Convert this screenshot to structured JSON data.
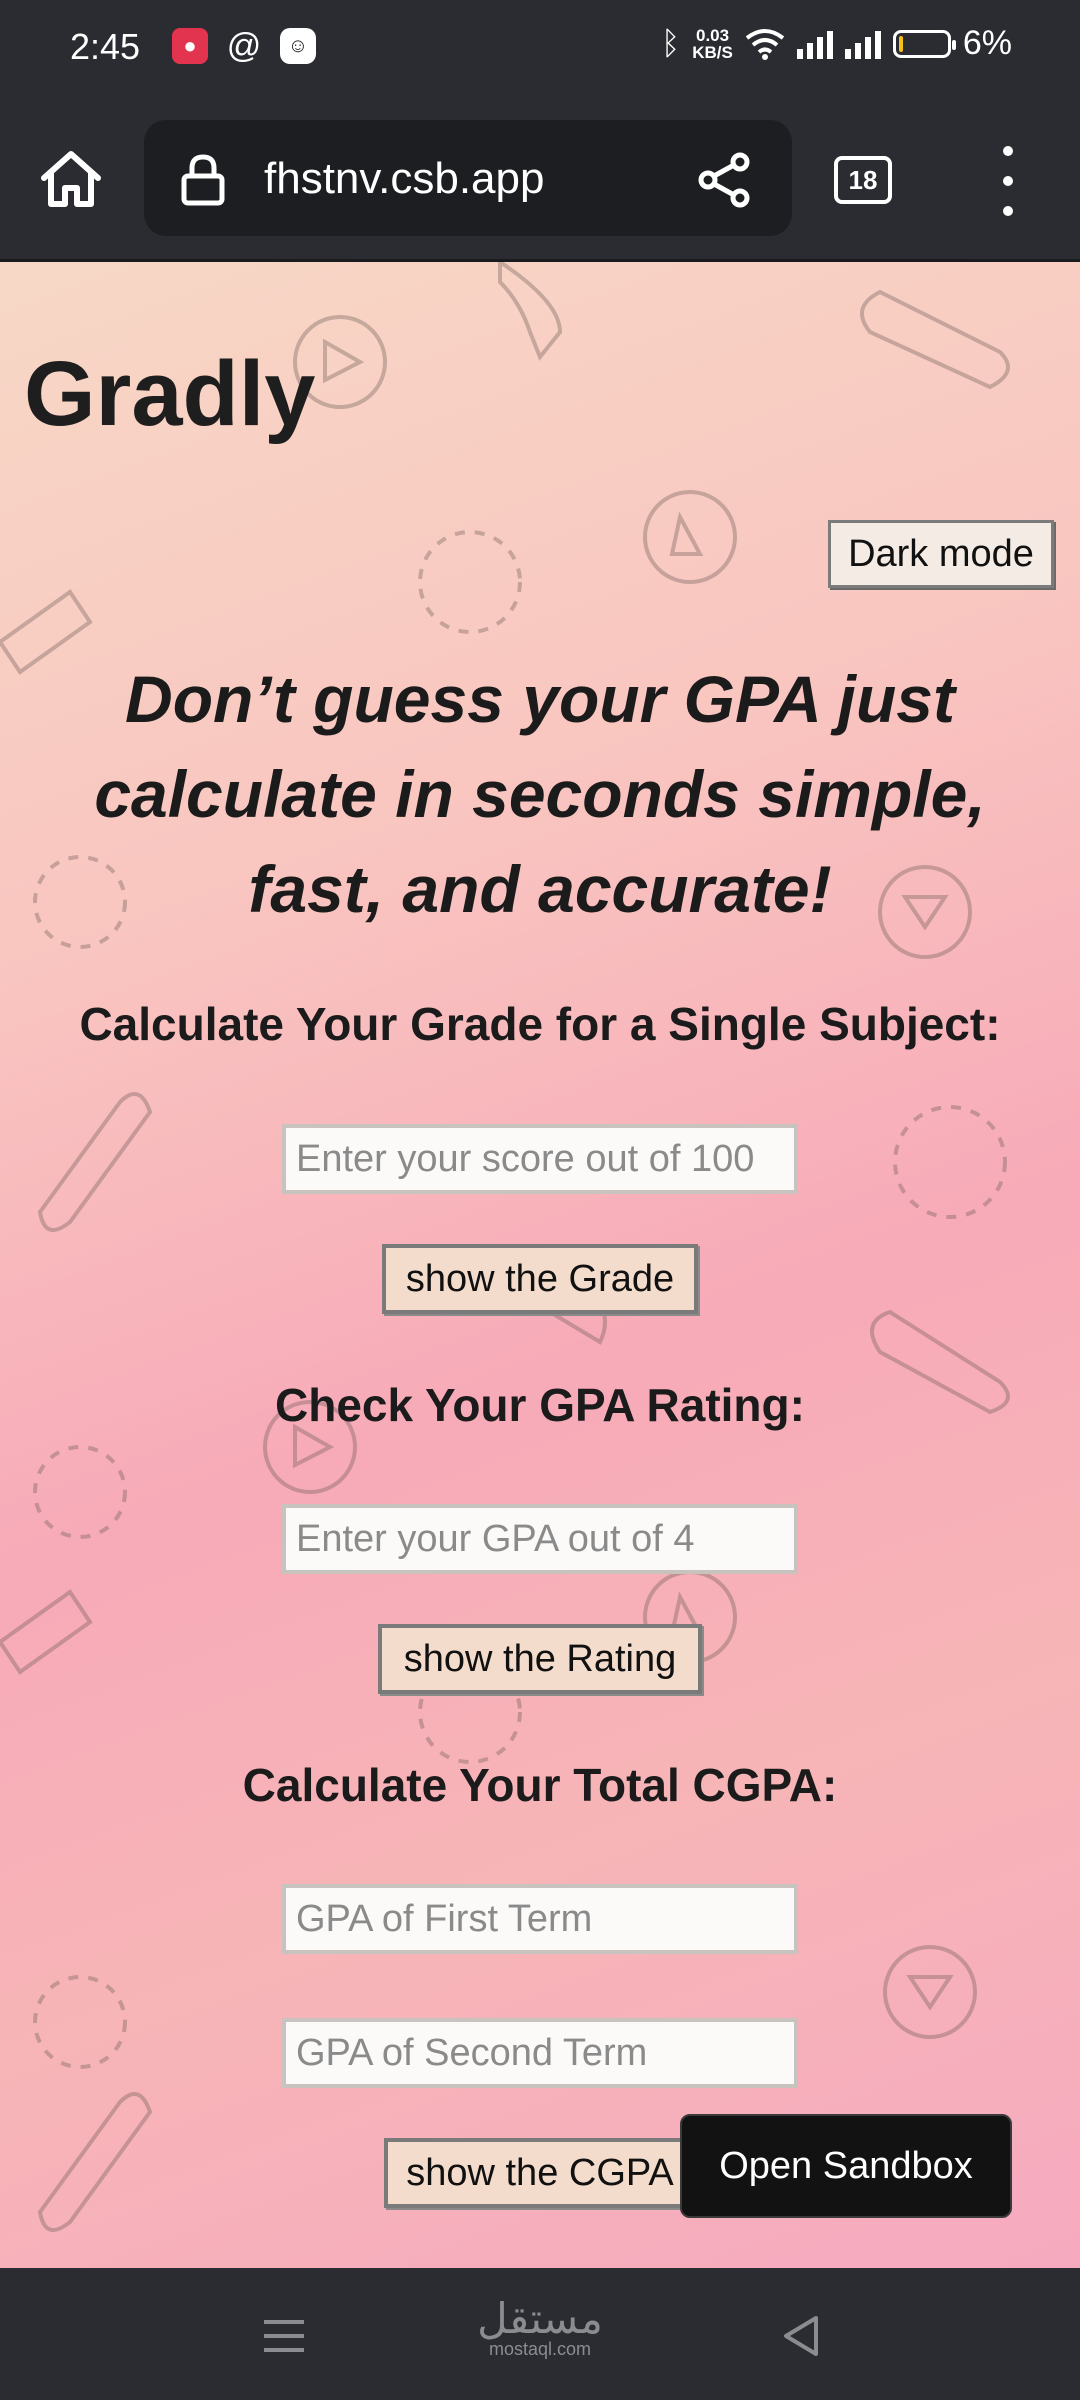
{
  "status_bar": {
    "time": "2:45",
    "net_speed": "0.03",
    "net_unit": "KB/S",
    "battery": "6%",
    "battery_level": 0.06
  },
  "browser": {
    "url": "fhstnv.csb.app",
    "tab_count": "18"
  },
  "page": {
    "title": "Gradly",
    "dark_mode_label": "Dark mode",
    "hero": "Don’t guess your GPA just calculate in seconds simple, fast, and accurate!",
    "grade_section": {
      "heading": "Calculate Your Grade for a Single Subject:",
      "placeholder": "Enter your score out of 100",
      "button": "show the Grade"
    },
    "gpa_section": {
      "heading": "Check Your GPA Rating:",
      "placeholder": "Enter your GPA out of 4",
      "button": "show the Rating"
    },
    "cgpa_section": {
      "heading": "Calculate Your Total CGPA:",
      "first_placeholder": "GPA of First Term",
      "second_placeholder": "GPA of Second Term",
      "button": "show the CGPA"
    },
    "sandbox_button": "Open Sandbox"
  },
  "watermark": {
    "arabic": "مستقل",
    "latin": "mostaql.com"
  },
  "colors": {
    "browser_bg": "#2b2c31",
    "page_gradient_start": "#f7d8c6",
    "page_gradient_end": "#f6aabf",
    "button_bg": "#f4dccc",
    "sandbox_bg": "#121212"
  },
  "icons": [
    "home-icon",
    "lock-icon",
    "share-icon",
    "tabs-icon",
    "more-vert-icon",
    "menu-icon",
    "back-icon"
  ]
}
